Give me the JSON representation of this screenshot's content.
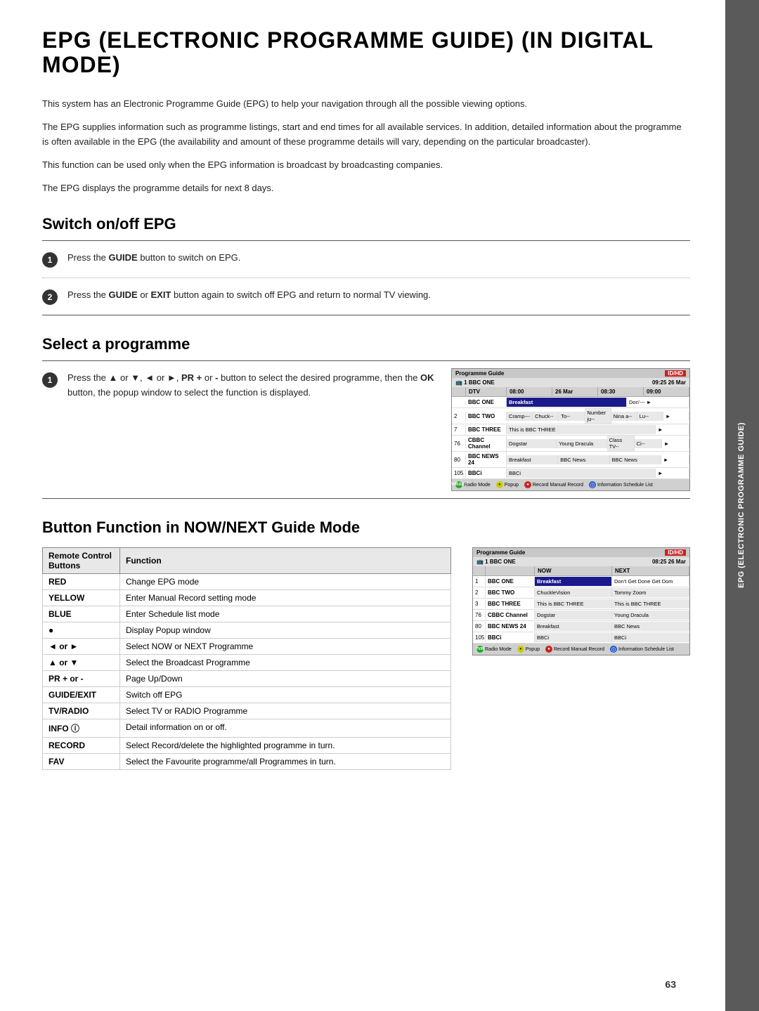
{
  "page": {
    "title": "EPG (ELECTRONIC PROGRAMME GUIDE) (IN DIGITAL MODE)",
    "page_number": "63"
  },
  "sidebar": {
    "line1": "EPG (ELECTRONIC PROGRAMME GUIDE)"
  },
  "intro": {
    "para1": "This system has an Electronic Programme Guide (EPG) to help your navigation through all the possible viewing options.",
    "para2": "The EPG supplies information such as programme listings, start and end times for all available services. In addition, detailed information about the programme is often available in the EPG (the availability and amount of these programme details will vary, depending on the particular broadcaster).",
    "para3": "This function can be used only when the EPG information is broadcast by broadcasting companies.",
    "para4": "The EPG displays the programme details for next 8 days."
  },
  "switch_epg": {
    "title": "Switch on/off EPG",
    "step1": "Press the GUIDE button to switch on EPG.",
    "step2": "Press the GUIDE or EXIT button again to switch off EPG and return to normal TV viewing."
  },
  "select_programme": {
    "title": "Select a programme",
    "step1_part1": "Press the ▲ or ▼, ◄ or ►, PR + or - button to select the desired programme, then the OK button, the popup window to select the function is displayed."
  },
  "epg_screen1": {
    "header_label": "Programme Guide",
    "logo": "ID/HD",
    "channel_label": "BBC ONE",
    "time_label": "09:25 26 Mar",
    "col_dtv": "DTV",
    "col_t1": "08:00",
    "col_t2": "26 Mar",
    "col_t3": "08:30",
    "col_t4": "09:00",
    "rows": [
      {
        "num": "",
        "name": "BBC ONE",
        "prog1": "Breakfast",
        "prog2": "Don'--- ►",
        "highlight": true
      },
      {
        "num": "2",
        "name": "BBC TWO",
        "prog1": "Cramp---",
        "prog2": "Chuck--",
        "prog3": "To--",
        "prog4": "Number ju--",
        "prog5": "Nina a--",
        "prog6": "Lu--",
        "prog7": "►"
      },
      {
        "num": "7",
        "name": "BBC THREE",
        "prog1": "This is BBC THREE",
        "prog2": "►"
      },
      {
        "num": "76",
        "name": "CBBC Channel",
        "prog1": "Dogstar",
        "prog2": "Young Dracula",
        "prog3": "Class TV--",
        "prog4": "Ci--",
        "prog5": "►"
      },
      {
        "num": "80",
        "name": "BBC NEWS 24",
        "prog1": "Breakfast",
        "prog2": "BBC News",
        "prog3": "BBC News",
        "prog4": "►"
      },
      {
        "num": "105",
        "name": "BBCi",
        "prog1": "BBCi",
        "prog2": "►"
      }
    ],
    "bottom": {
      "btn1_label": "TV/RADIO",
      "btn1_sub": "Radio",
      "btn1_color": "#22aa22",
      "btn2_label": "",
      "btn2_sub": "Popup",
      "btn2_color": "#cccc00",
      "btn3_label": "",
      "btn3_sub": "Record Manual Record",
      "btn3_color": "#cc2222",
      "btn4_label": "ⓘ",
      "btn4_sub": "Information Schedule List",
      "btn4_color": "#2255cc"
    }
  },
  "btn_function_section": {
    "title": "Button Function in NOW/NEXT Guide Mode",
    "table": {
      "col1_header": "Remote Control Buttons",
      "col2_header": "Function",
      "rows": [
        {
          "button": "RED",
          "function": "Change EPG mode"
        },
        {
          "button": "YELLOW",
          "function": "Enter Manual Record setting mode"
        },
        {
          "button": "BLUE",
          "function": "Enter Schedule list mode"
        },
        {
          "button": "●",
          "function": "Display Popup window"
        },
        {
          "button": "◄ or ►",
          "function": "Select NOW or NEXT Programme"
        },
        {
          "button": "▲ or ▼",
          "function": "Select the Broadcast Programme"
        },
        {
          "button": "PR + or -",
          "function": "Page Up/Down"
        },
        {
          "button": "GUIDE/EXIT",
          "function": "Switch off EPG"
        },
        {
          "button": "TV/RADIO",
          "function": "Select TV or RADIO Programme"
        },
        {
          "button": "INFO ⓘ",
          "function": "Detail information on or off."
        },
        {
          "button": "RECORD",
          "function": "Select Record/delete the highlighted programme in turn."
        },
        {
          "button": "FAV",
          "function": "Select the Favourite programme/all Programmes in turn."
        }
      ]
    }
  },
  "epg_screen2": {
    "header_label": "Programme Guide",
    "logo": "ID/HD",
    "channel_label": "BBC ONE",
    "time_label": "08:25 26 Mar",
    "col_now": "NOW",
    "col_next": "NEXT",
    "rows": [
      {
        "num": "1",
        "name": "BBC ONE",
        "now": "Breakfast",
        "next": "Don't Get Done Get Dom",
        "highlight_now": true
      },
      {
        "num": "2",
        "name": "BBC TWO",
        "now": "ChuckleVision",
        "next": "Tommy Zoom"
      },
      {
        "num": "3",
        "name": "BBC THREE",
        "now": "This is BBC THREE",
        "next": "This is BBC THREE"
      },
      {
        "num": "76",
        "name": "CBBC Channel",
        "now": "Dogstar",
        "next": "Young Dracula"
      },
      {
        "num": "80",
        "name": "BBC NEWS 24",
        "now": "Breakfast",
        "next": "BBC News"
      },
      {
        "num": "105",
        "name": "BBCi",
        "now": "BBCi",
        "next": "BBCi"
      }
    ],
    "bottom": {
      "btn1_label": "TV/RADIO",
      "btn1_sub": "Radio",
      "btn2_sub": "Popup",
      "btn3_sub": "Record Manual Record",
      "btn4_sub": "ⓘ Information Schedule List"
    }
  }
}
